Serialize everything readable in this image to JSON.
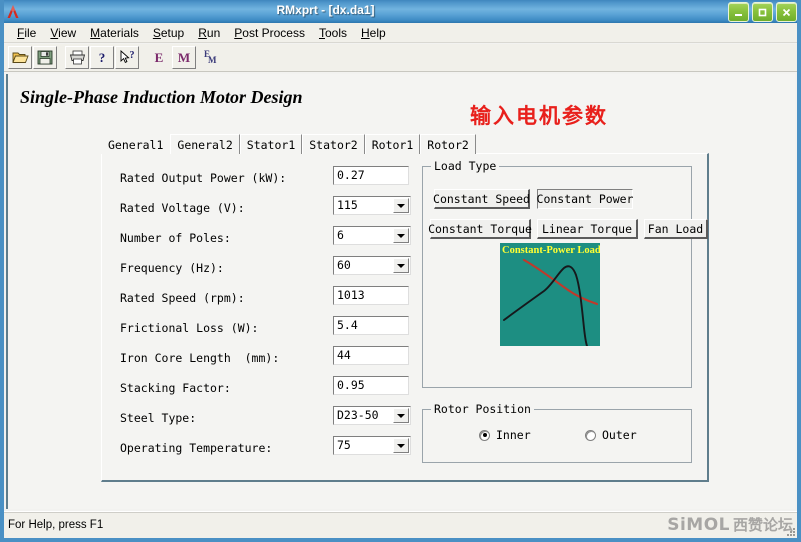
{
  "window": {
    "title": "RMxprt - [dx.da1]",
    "app_icon": "ansoft-a-icon",
    "minimize_label": "Minimize",
    "restore_label": "Restore",
    "close_label": "Close"
  },
  "menubar": {
    "items": [
      {
        "label": "File",
        "mnemonic": "F"
      },
      {
        "label": "View",
        "mnemonic": "V"
      },
      {
        "label": "Materials",
        "mnemonic": "M"
      },
      {
        "label": "Setup",
        "mnemonic": "S"
      },
      {
        "label": "Run",
        "mnemonic": "R"
      },
      {
        "label": "Post Process",
        "mnemonic": "P"
      },
      {
        "label": "Tools",
        "mnemonic": "T"
      },
      {
        "label": "Help",
        "mnemonic": "H"
      }
    ]
  },
  "toolbar": {
    "buttons": [
      {
        "name": "open-icon",
        "glyph": ""
      },
      {
        "name": "save-icon",
        "glyph": ""
      },
      {
        "name": "print-icon",
        "glyph": ""
      },
      {
        "name": "help-icon",
        "glyph": ""
      },
      {
        "name": "context-help-icon",
        "glyph": ""
      },
      {
        "name": "electric-icon",
        "glyph": "E"
      },
      {
        "name": "magnetic-icon",
        "glyph": "M"
      },
      {
        "name": "electromagnetic-icon",
        "glyph": "EM"
      }
    ]
  },
  "document": {
    "design_title": "Single-Phase Induction Motor Design",
    "chinese_heading": "输入电机参数"
  },
  "tabs": [
    {
      "label": "General1",
      "active": true
    },
    {
      "label": "General2",
      "active": false
    },
    {
      "label": "Stator1",
      "active": false
    },
    {
      "label": "Stator2",
      "active": false
    },
    {
      "label": "Rotor1",
      "active": false
    },
    {
      "label": "Rotor2",
      "active": false
    }
  ],
  "form": {
    "fields": [
      {
        "label": "Rated Output Power (kW):",
        "value": "0.27",
        "type": "text"
      },
      {
        "label": "Rated Voltage (V):",
        "value": "115",
        "type": "combo"
      },
      {
        "label": "Number of Poles:",
        "value": "6",
        "type": "combo"
      },
      {
        "label": "Frequency (Hz):",
        "value": "60",
        "type": "combo"
      },
      {
        "label": "Rated Speed (rpm):",
        "value": "1013",
        "type": "text"
      },
      {
        "label": "Frictional Loss (W):",
        "value": "5.4",
        "type": "text"
      },
      {
        "label": "Iron Core Length  (mm):",
        "value": "44",
        "type": "text"
      },
      {
        "label": "Stacking Factor:",
        "value": "0.95",
        "type": "text"
      },
      {
        "label": "Steel Type:",
        "value": "D23-50",
        "type": "combo"
      },
      {
        "label": "Operating Temperature:",
        "value": "75",
        "type": "combo"
      }
    ]
  },
  "load_type": {
    "title": "Load Type",
    "buttons": [
      {
        "label": "Constant Speed",
        "selected": false
      },
      {
        "label": "Constant Power",
        "selected": true
      },
      {
        "label": "Constant Torque",
        "selected": false
      },
      {
        "label": "Linear Torque",
        "selected": false
      },
      {
        "label": "Fan Load",
        "selected": false
      }
    ],
    "preview": {
      "caption": "Constant-Power Load",
      "background_color": "#1d8e82",
      "caption_color": "#ffff33",
      "load_curve_color": "#c0392b",
      "torque_curve_color": "#1a1a1a"
    }
  },
  "rotor_position": {
    "title": "Rotor Position",
    "options": [
      {
        "label": "Inner",
        "selected": true
      },
      {
        "label": "Outer",
        "selected": false
      }
    ]
  },
  "statusbar": {
    "text": "For Help, press F1",
    "watermark_latin": "SiMOL",
    "watermark_cn": "西赞论坛"
  },
  "colors": {
    "titlebar_blue": "#4a90c4",
    "heading_red": "#e8201c",
    "chart_teal": "#1d8e82",
    "window_bg": "#f4f4f2"
  }
}
